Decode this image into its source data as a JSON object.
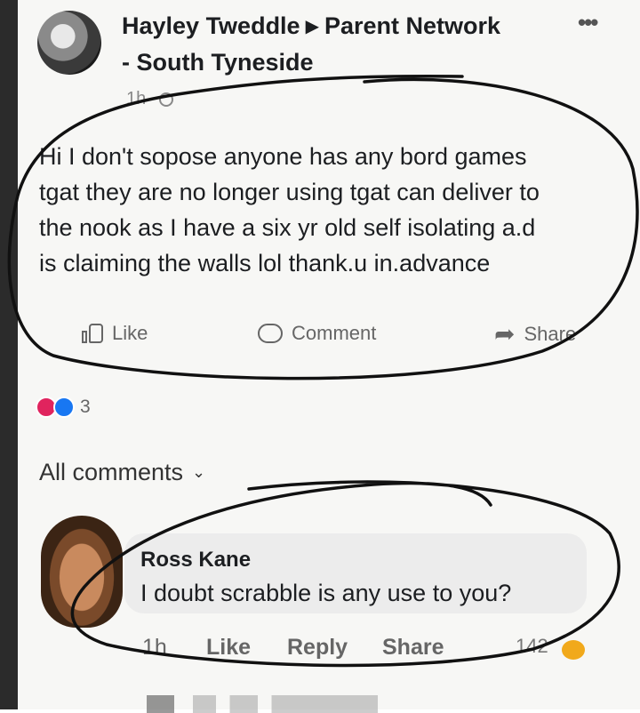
{
  "post": {
    "author": "Hayley Tweddle",
    "group_line1": "Parent Network",
    "group_line2": "- South Tyneside",
    "time": "1h",
    "more_icon": "more-horizontal-icon",
    "body": "Hi I don't sopose anyone has any bord games\ntgat they are no longer using tgat can deliver to\nthe nook as I have a six yr old self isolating a.d\nis claiming the walls lol  thank.u in.advance"
  },
  "actions": {
    "like": "Like",
    "comment": "Comment",
    "share": "Share"
  },
  "reactions": {
    "count": "3",
    "colors": {
      "love": "#e0245e",
      "like": "#1877f2"
    }
  },
  "comments_filter": {
    "label": "All comments"
  },
  "comment": {
    "author": "Ross Kane",
    "text": "I doubt scrabble is any use to you?",
    "time": "1h",
    "like": "Like",
    "reply": "Reply",
    "share": "Share",
    "reaction_count": "142"
  }
}
